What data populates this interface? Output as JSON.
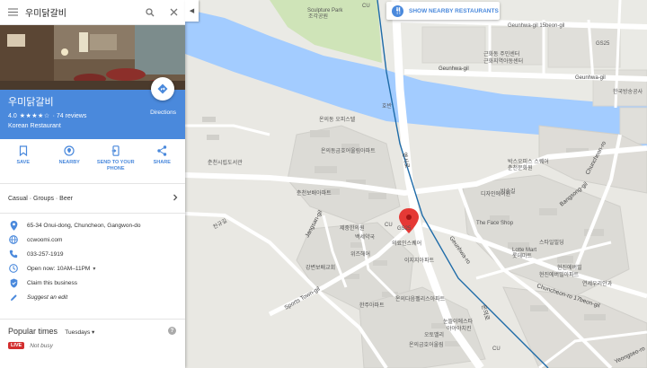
{
  "search": {
    "query": "우미닭갈비"
  },
  "place": {
    "name": "우미닭갈비",
    "rating": "4.0",
    "stars": "★★★★☆",
    "reviews": "· 74 reviews",
    "category": "Korean Restaurant",
    "directions_label": "Directions"
  },
  "actions": [
    {
      "label": "SAVE",
      "icon": "bookmark-icon"
    },
    {
      "label": "NEARBY",
      "icon": "nearby-icon"
    },
    {
      "label": "SEND TO YOUR PHONE",
      "icon": "phone-icon"
    },
    {
      "label": "SHARE",
      "icon": "share-icon"
    }
  ],
  "attributes": {
    "text": "Casual · Groups · Beer"
  },
  "details": {
    "address": "65-34 Onui-dong, Chuncheon, Gangwon-do",
    "website": "ccwoomi.com",
    "phone": "033-257-1919",
    "hours": "Open now:  10AM–11PM",
    "claim": "Claim this business",
    "suggest": "Suggest an edit"
  },
  "popular_times": {
    "title": "Popular times",
    "day": "Tuesdays",
    "live_badge": "LIVE",
    "live_status": "Not busy",
    "help": "?"
  },
  "map": {
    "nearby_button": "SHOW NEARBY RESTAURANTS",
    "accent": "#4a89dc",
    "water": "#a3ccff",
    "labels": {
      "sculpture_park": "Sculpture Park",
      "sculpture_park2": "조각공원",
      "street_15beon": "Geunhwa-gil 15beon-gil",
      "geunhwa_gil": "Geunhwa-gil",
      "geunhwa_gil2": "Geunhwa-gil",
      "gs25_a": "GS25",
      "gs25_b": "GS25",
      "cu_a": "CU",
      "cu_b": "CU",
      "cu_c": "CU",
      "apt1": "근화동 주민센터",
      "apt2": "근화지역아동센터",
      "apt3": "춘천시립도서관",
      "apt4": "제중한의원",
      "apt5": "온의동금호어울림아파트",
      "apt6": "온의동 오피스텔",
      "apt7": "한국방송공사",
      "apt8": "박스오피스 스퀘어",
      "apt9": "춘천문화원",
      "apt10": "The Face Shop",
      "apt11": "Lotte Mart",
      "apt12": "롯데마트",
      "apt13": "스타일빌딩",
      "apt14": "현진에버빌아파트",
      "apt15": "연세우리안과",
      "apt16": "춘천보배아파트",
      "apt17": "백세약국",
      "apt18": "강변보배교회",
      "apt19": "의료인스퀘어",
      "apt20": "온의다음펠리스아파트",
      "apt21": "현진에버빌",
      "apt22": "온의금호어울림",
      "apt23": "위즈해어",
      "apt24": "눈뜰이에스타",
      "apt25": "야야야치킨",
      "apt26": "오토밸리",
      "apt27": "한주아파트",
      "apt28": "디자인에이원",
      "apt29": "이지지아파트",
      "road_jangsan": "Jangsan-gil",
      "road_sports": "Sports Town-gil",
      "road_geunhwa_ro": "Geunhwa-ro",
      "road_bangsong": "Bangsong-gil",
      "road_chuncheon": "Chuncheon-ro 17beon-gil",
      "road_chuncheon2": "Chuncheon-ro",
      "road_yeongseo": "Yeongseo-ro",
      "road_yeongseo_kr": "영서로",
      "road_onui": "온의로",
      "hoban": "호반",
      "bangsong_kr": "방송길",
      "suganggil": "찬규길"
    }
  }
}
